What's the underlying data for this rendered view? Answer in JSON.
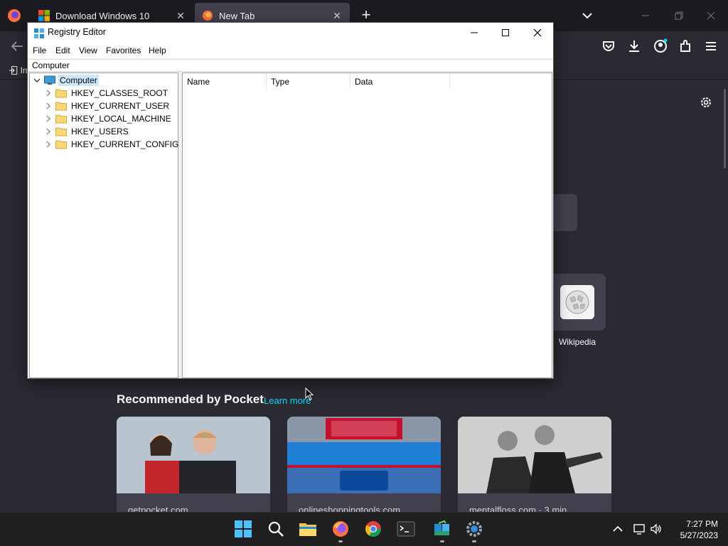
{
  "browser": {
    "tabs": [
      {
        "title": "Download Windows 10",
        "icon": "windows-logo-icon"
      },
      {
        "title": "New Tab",
        "icon": "firefox-logo-icon",
        "active": true
      }
    ],
    "bookmarks_import_label": "Im"
  },
  "new_tab": {
    "shortcut": {
      "label": "Wikipedia",
      "icon": "wikipedia-globe-icon"
    },
    "pocket": {
      "heading": "Recommended by Pocket",
      "learn_more": "Learn more",
      "cards": [
        {
          "source": "getpocket.com"
        },
        {
          "source": "onlineshoppingtools.com"
        },
        {
          "source": "mentalfloss.com · 3 min"
        }
      ]
    }
  },
  "regedit": {
    "title": "Registry Editor",
    "menu": [
      "File",
      "Edit",
      "View",
      "Favorites",
      "Help"
    ],
    "address": "Computer",
    "tree": {
      "root": "Computer",
      "children": [
        "HKEY_CLASSES_ROOT",
        "HKEY_CURRENT_USER",
        "HKEY_LOCAL_MACHINE",
        "HKEY_USERS",
        "HKEY_CURRENT_CONFIG"
      ]
    },
    "columns": [
      "Name",
      "Type",
      "Data"
    ]
  },
  "taskbar": {
    "apps": [
      "start-icon",
      "search-icon",
      "file-explorer-icon",
      "firefox-icon",
      "chrome-icon",
      "terminal-icon",
      "registry-editor-icon",
      "settings-icon"
    ],
    "clock": {
      "time": "7:27 PM",
      "date": "5/27/2023"
    }
  },
  "colors": {
    "accent_link": "#00ddff",
    "selection": "#cce8ff",
    "taskbar": "#1f1f1f",
    "browser_bg": "#2b2a33"
  }
}
